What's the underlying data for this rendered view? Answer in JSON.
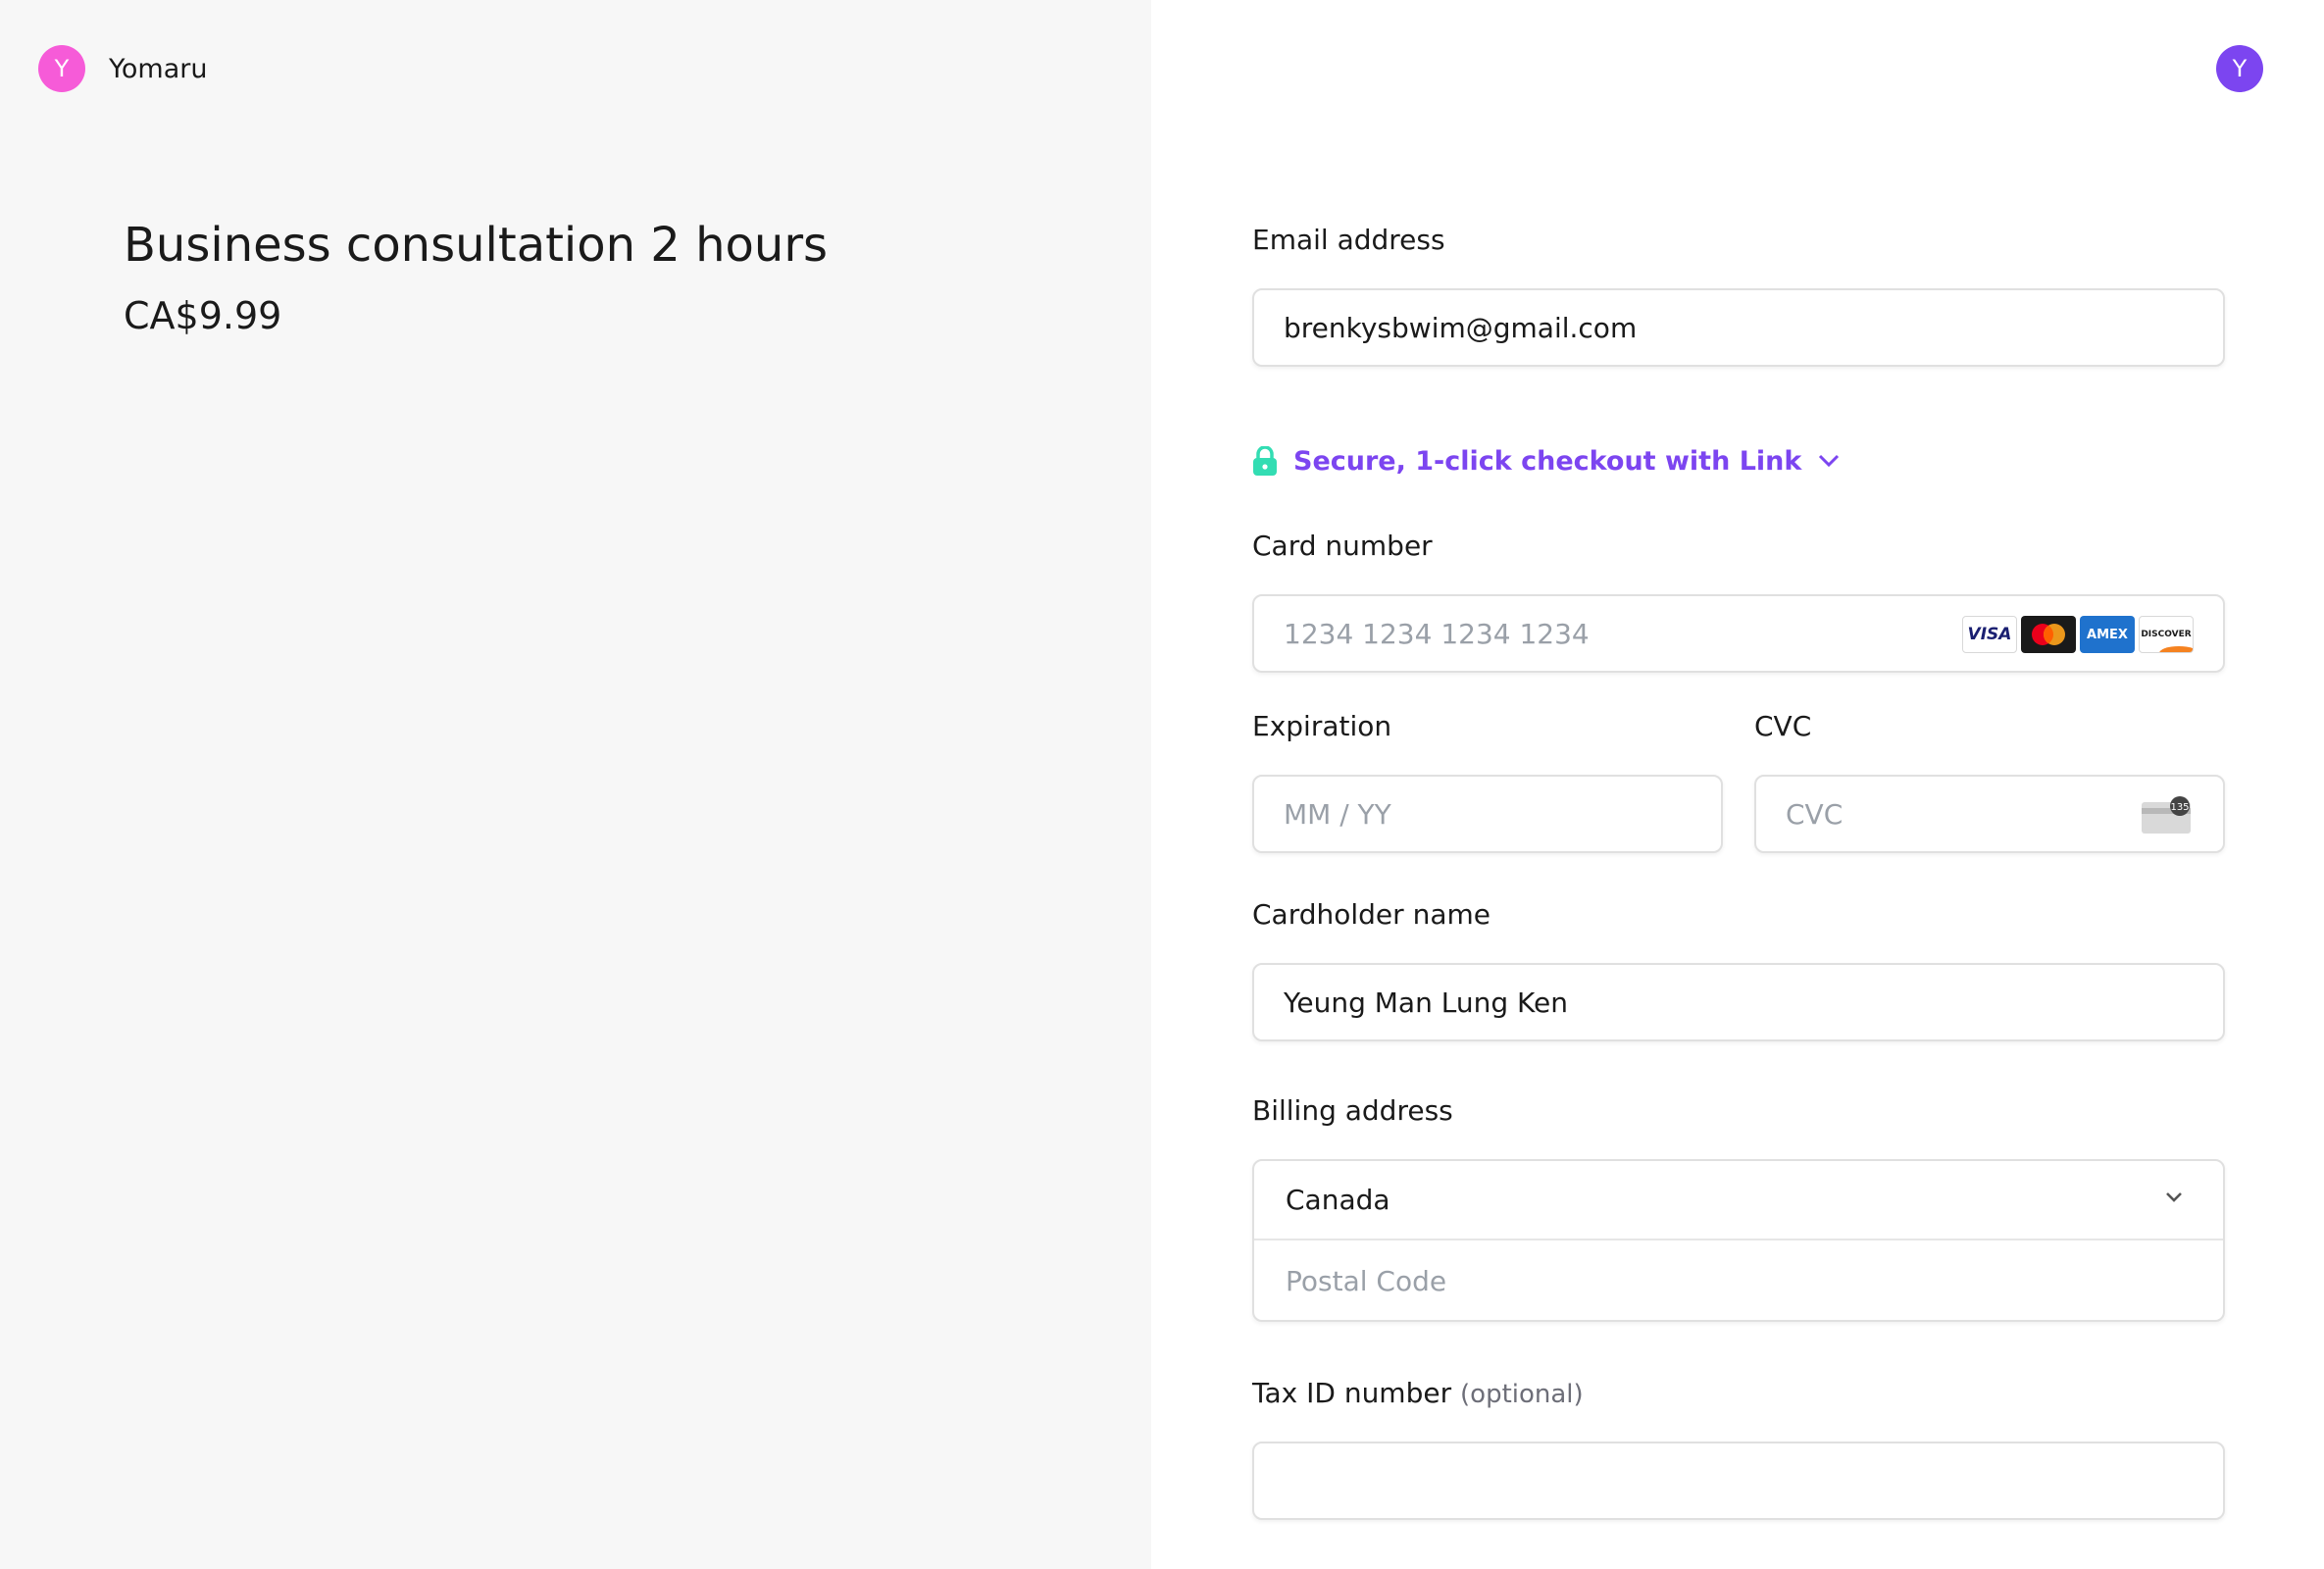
{
  "merchant": {
    "avatar_letter": "Y",
    "name": "Yomaru",
    "avatar_color": "#f65bd8"
  },
  "user": {
    "avatar_letter": "Y",
    "avatar_color": "#7c45f0"
  },
  "product": {
    "title": "Business consultation 2 hours",
    "price": "CA$9.99"
  },
  "form": {
    "email": {
      "label": "Email address",
      "value": "brenkysbwim@gmail.com"
    },
    "link": {
      "text": "Secure, 1-click checkout with Link",
      "icon": "lock-icon",
      "icon_color": "#33ddb3",
      "text_color": "#7c45f0"
    },
    "card_number": {
      "label": "Card number",
      "placeholder": "1234 1234 1234 1234",
      "brands": [
        "VISA",
        "AMEX",
        "DISCOVER"
      ]
    },
    "expiration": {
      "label": "Expiration",
      "placeholder": "MM / YY"
    },
    "cvc": {
      "label": "CVC",
      "placeholder": "CVC",
      "icon_badge": "135"
    },
    "cardholder": {
      "label": "Cardholder name",
      "value": "Yeung Man Lung Ken"
    },
    "billing": {
      "label": "Billing address",
      "country": "Canada",
      "postal_placeholder": "Postal Code"
    },
    "tax_id": {
      "label": "Tax ID number",
      "optional": "(optional)",
      "value": ""
    }
  }
}
